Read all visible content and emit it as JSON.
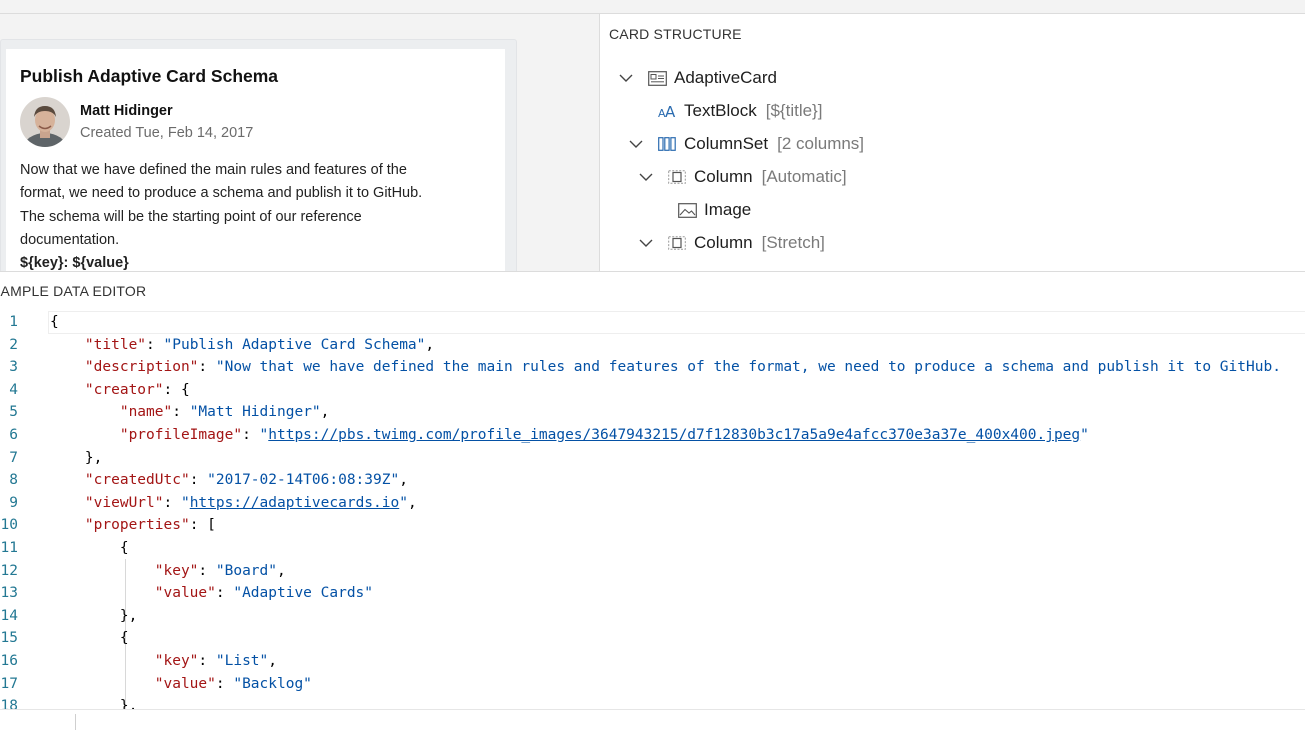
{
  "preview": {
    "card": {
      "title": "Publish Adaptive Card Schema",
      "creator_name": "Matt Hidinger",
      "created": "Created Tue, Feb 14, 2017",
      "description_lines": [
        "Now that we have defined the main rules and features of the",
        "format, we need to produce a schema and publish it to GitHub.",
        "The schema will be the starting point of our reference",
        "documentation."
      ],
      "cutoff_text": "${key}: ${value}"
    }
  },
  "structure": {
    "header": "CARD STRUCTURE",
    "nodes": [
      {
        "label": "AdaptiveCard",
        "hint": "",
        "icon": "adaptive-card-icon"
      },
      {
        "label": "TextBlock",
        "hint": "[${title}]",
        "icon": "text-block-icon"
      },
      {
        "label": "ColumnSet",
        "hint": "[2 columns]",
        "icon": "column-set-icon"
      },
      {
        "label": "Column",
        "hint": "[Automatic]",
        "icon": "column-icon"
      },
      {
        "label": "Image",
        "hint": "",
        "icon": "image-icon"
      },
      {
        "label": "Column",
        "hint": "[Stretch]",
        "icon": "column-icon"
      }
    ]
  },
  "editor": {
    "header": "SAMPLE DATA EDITOR",
    "line_numbers": [
      "1",
      "2",
      "3",
      "4",
      "5",
      "6",
      "7",
      "8",
      "9",
      "10",
      "11",
      "12",
      "13",
      "14",
      "15",
      "16",
      "17",
      "18"
    ],
    "json": {
      "title_key": "\"title\"",
      "title_val": "\"Publish Adaptive Card Schema\"",
      "desc_key": "\"description\"",
      "desc_val": "\"Now that we have defined the main rules and features of the format, we need to produce a schema and publish it to GitHub.",
      "creator_key": "\"creator\"",
      "name_key": "\"name\"",
      "name_val": "\"Matt Hidinger\"",
      "profile_key": "\"profileImage\"",
      "profile_url": "https://pbs.twimg.com/profile_images/3647943215/d7f12830b3c17a5a9e4afcc370e3a37e_400x400.jpeg",
      "created_key": "\"createdUtc\"",
      "created_val": "\"2017-02-14T06:08:39Z\"",
      "viewurl_key": "\"viewUrl\"",
      "viewurl_url": "https://adaptivecards.io",
      "properties_key": "\"properties\"",
      "key_key": "\"key\"",
      "value_key": "\"value\"",
      "board_val": "\"Board\"",
      "adaptive_val": "\"Adaptive Cards\"",
      "list_val": "\"List\"",
      "backlog_val": "\"Backlog\""
    }
  }
}
